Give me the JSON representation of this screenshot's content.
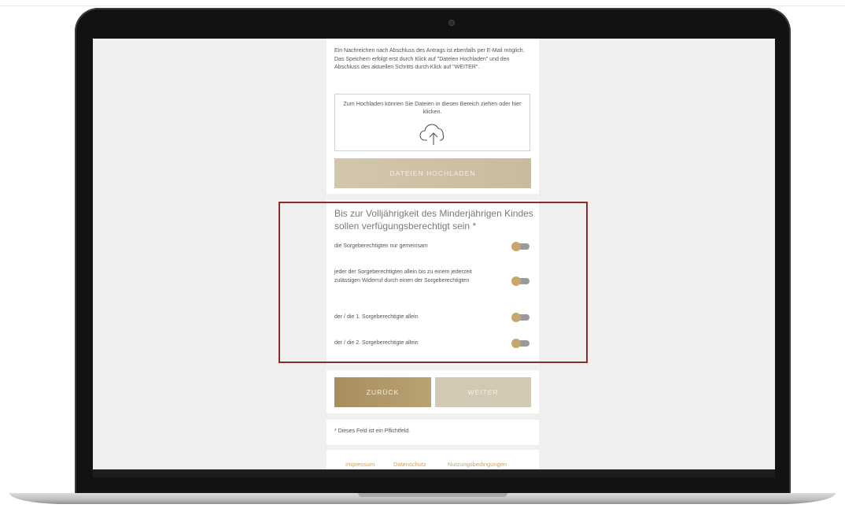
{
  "page": {
    "info_text": "Ein Nachreichen nach Abschluss des Antrags ist ebenfalls per E-Mail möglich. Das Speichern erfolgt erst durch Klick auf \"Dateien Hochladen\" und den Abschluss des aktuellen Schritts durch Klick auf \"WEITER\".",
    "dropzone_text": "Zum Hochladen können Sie Dateien in diesen Bereich ziehen oder hier klicken.",
    "upload_button": "DATEIEN HOCHLADEN",
    "question": "Bis zur Volljährigkeit des Minderjährigen Kindes sollen verfügungsberechtigt sein *",
    "options": [
      {
        "label": "die Sorgeberechtigten nur gemeinsam",
        "on": false
      },
      {
        "label": "jeder der Sorgeberechtigten allein bis zu einem jederzeit zulässigen Widerruf durch einen der Sorgeberechtigten",
        "on": false
      },
      {
        "label": "der / die 1. Sorgeberechtigte allein",
        "on": false
      },
      {
        "label": "der / die 2. Sorgeberechtigte allein",
        "on": false
      }
    ],
    "back_button": "ZURÜCK",
    "next_button": "WEITER",
    "required_note": "* Dieses Feld ist ein Pflichtfeld.",
    "footer_links": [
      "Impressum",
      "Datenschutz",
      "Nutzungsbedingungen"
    ]
  },
  "colors": {
    "accent_gold": "#c7a76d",
    "button_primary": "#a88e5d",
    "button_disabled": "#d3c8b3",
    "highlight_border": "#8e2a2a"
  },
  "icons": [
    "cloud-upload-icon",
    "camera-icon"
  ]
}
